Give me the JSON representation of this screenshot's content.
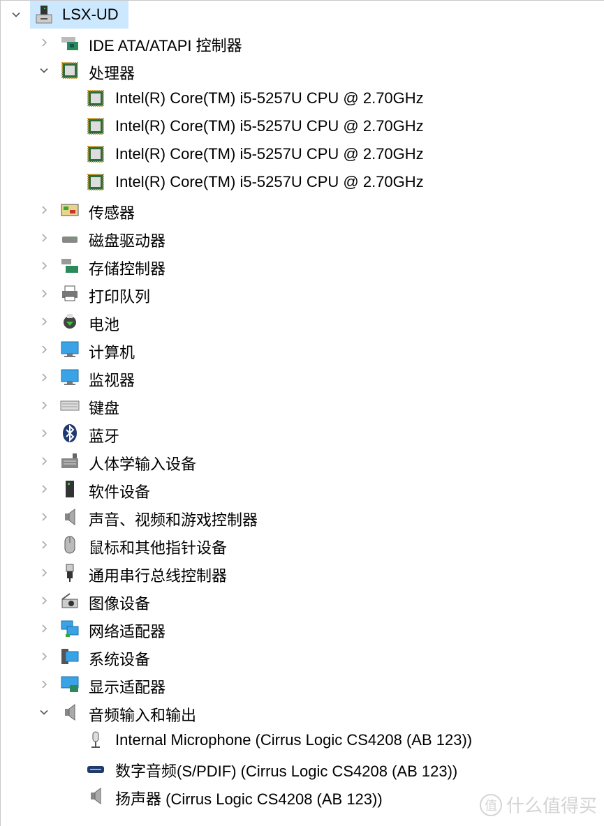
{
  "root": {
    "label": "LSX-UD",
    "expanded": true,
    "icon": "computer-tower-icon",
    "selected_bg": "#cce8ff"
  },
  "items": [
    {
      "level": 1,
      "expanded": false,
      "label": "IDE ATA/ATAPI 控制器",
      "icon": "ide-controller-icon"
    },
    {
      "level": 1,
      "expanded": true,
      "label": "处理器",
      "icon": "processor-icon"
    },
    {
      "level": 2,
      "label": "Intel(R) Core(TM) i5-5257U CPU @ 2.70GHz",
      "icon": "processor-icon"
    },
    {
      "level": 2,
      "label": "Intel(R) Core(TM) i5-5257U CPU @ 2.70GHz",
      "icon": "processor-icon"
    },
    {
      "level": 2,
      "label": "Intel(R) Core(TM) i5-5257U CPU @ 2.70GHz",
      "icon": "processor-icon"
    },
    {
      "level": 2,
      "label": "Intel(R) Core(TM) i5-5257U CPU @ 2.70GHz",
      "icon": "processor-icon"
    },
    {
      "level": 1,
      "expanded": false,
      "label": "传感器",
      "icon": "sensor-icon"
    },
    {
      "level": 1,
      "expanded": false,
      "label": "磁盘驱动器",
      "icon": "disk-drive-icon"
    },
    {
      "level": 1,
      "expanded": false,
      "label": "存储控制器",
      "icon": "storage-controller-icon"
    },
    {
      "level": 1,
      "expanded": false,
      "label": "打印队列",
      "icon": "printer-icon"
    },
    {
      "level": 1,
      "expanded": false,
      "label": "电池",
      "icon": "battery-icon"
    },
    {
      "level": 1,
      "expanded": false,
      "label": "计算机",
      "icon": "computer-icon"
    },
    {
      "level": 1,
      "expanded": false,
      "label": "监视器",
      "icon": "monitor-icon"
    },
    {
      "level": 1,
      "expanded": false,
      "label": "键盘",
      "icon": "keyboard-icon"
    },
    {
      "level": 1,
      "expanded": false,
      "label": "蓝牙",
      "icon": "bluetooth-icon"
    },
    {
      "level": 1,
      "expanded": false,
      "label": "人体学输入设备",
      "icon": "hid-icon"
    },
    {
      "level": 1,
      "expanded": false,
      "label": "软件设备",
      "icon": "software-device-icon"
    },
    {
      "level": 1,
      "expanded": false,
      "label": "声音、视频和游戏控制器",
      "icon": "speaker-icon"
    },
    {
      "level": 1,
      "expanded": false,
      "label": "鼠标和其他指针设备",
      "icon": "mouse-icon"
    },
    {
      "level": 1,
      "expanded": false,
      "label": "通用串行总线控制器",
      "icon": "usb-icon"
    },
    {
      "level": 1,
      "expanded": false,
      "label": "图像设备",
      "icon": "camera-icon"
    },
    {
      "level": 1,
      "expanded": false,
      "label": "网络适配器",
      "icon": "network-icon"
    },
    {
      "level": 1,
      "expanded": false,
      "label": "系统设备",
      "icon": "system-device-icon"
    },
    {
      "level": 1,
      "expanded": false,
      "label": "显示适配器",
      "icon": "display-adapter-icon"
    },
    {
      "level": 1,
      "expanded": true,
      "label": "音频输入和输出",
      "icon": "speaker-icon"
    },
    {
      "level": 2,
      "label": "Internal Microphone (Cirrus Logic CS4208 (AB 123))",
      "icon": "microphone-icon"
    },
    {
      "level": 2,
      "label": "数字音频(S/PDIF) (Cirrus Logic CS4208 (AB 123))",
      "icon": "spdif-icon"
    },
    {
      "level": 2,
      "label": "扬声器 (Cirrus Logic CS4208 (AB 123))",
      "icon": "speaker-icon"
    }
  ],
  "watermark": {
    "logo": "值",
    "text": "什么值得买"
  }
}
